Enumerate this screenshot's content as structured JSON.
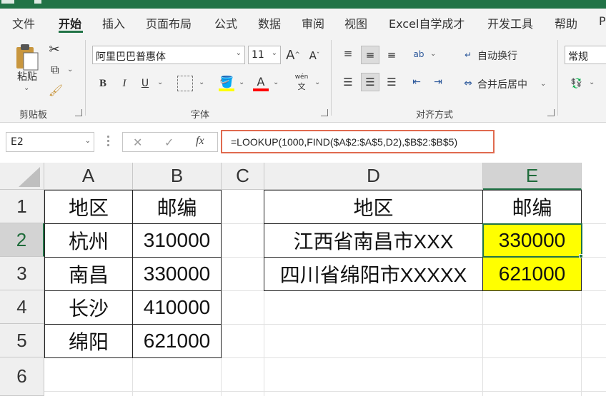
{
  "tabs": [
    "文件",
    "开始",
    "插入",
    "页面布局",
    "公式",
    "数据",
    "审阅",
    "视图",
    "Excel自学成才",
    "开发工具",
    "帮助",
    "P"
  ],
  "active_tab": "开始",
  "ribbon": {
    "clipboard": {
      "paste_label": "粘贴",
      "group_label": "剪贴板"
    },
    "font": {
      "font_name": "阿里巴巴普惠体",
      "font_size": "11",
      "grow_label": "A",
      "shrink_label": "A",
      "bold": "B",
      "italic": "I",
      "underline": "U",
      "fill_label": "A",
      "font_color_label": "A",
      "phonetic_top": "wén",
      "phonetic_bottom": "文",
      "group_label": "字体",
      "fill_color": "#ffff00",
      "font_color": "#ff0000"
    },
    "alignment": {
      "wrap_text": "自动换行",
      "merge_center": "合并后居中",
      "group_label": "对齐方式",
      "orientation_label": "ab"
    },
    "number": {
      "format": "常规"
    }
  },
  "formula_bar": {
    "name_box": "E2",
    "cancel": "✕",
    "enter": "✓",
    "fx": "fx",
    "formula": "=LOOKUP(1000,FIND($A$2:$A$5,D2),$B$2:$B$5)"
  },
  "sheet": {
    "columns": [
      "A",
      "B",
      "C",
      "D",
      "E"
    ],
    "selected_column": "E",
    "rows": [
      "1",
      "2",
      "3",
      "4",
      "5",
      "6"
    ],
    "selected_row": "2",
    "table1": {
      "header": [
        "地区",
        "邮编"
      ],
      "rows": [
        [
          "杭州",
          "310000"
        ],
        [
          "南昌",
          "330000"
        ],
        [
          "长沙",
          "410000"
        ],
        [
          "绵阳",
          "621000"
        ]
      ]
    },
    "table2": {
      "header": [
        "地区",
        "邮编"
      ],
      "rows": [
        [
          "江西省南昌市XXX",
          "330000"
        ],
        [
          "四川省绵阳市XXXXX",
          "621000"
        ]
      ]
    },
    "highlight_color": "#ffff00",
    "accent_color": "#217346"
  }
}
